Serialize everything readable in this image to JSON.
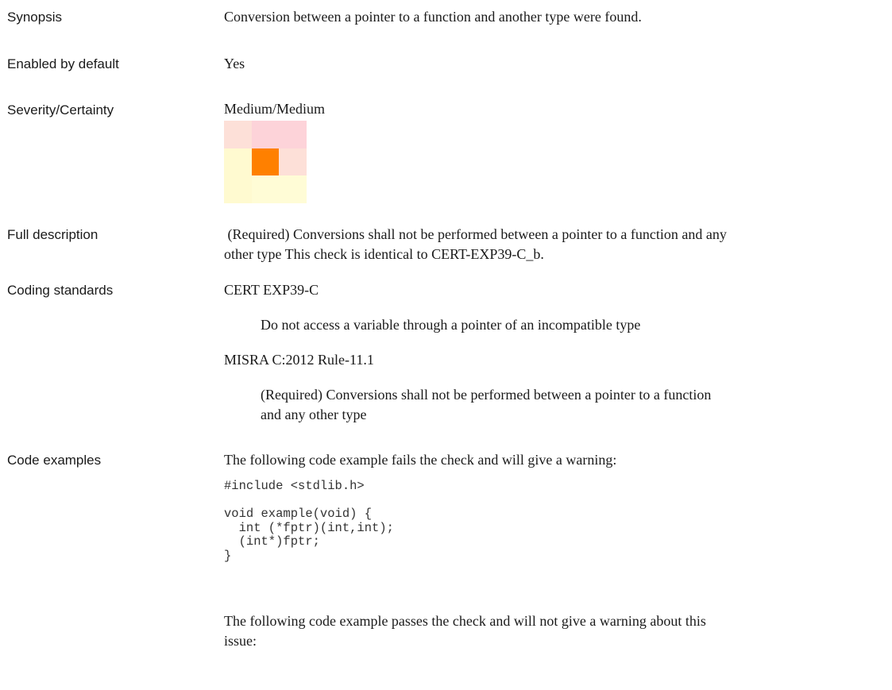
{
  "rows": {
    "synopsis": {
      "label": "Synopsis",
      "value": "Conversion between a pointer to a function and another type were found."
    },
    "enabled": {
      "label": "Enabled by default",
      "value": "Yes"
    },
    "severity": {
      "label": "Severity/Certainty",
      "value": "Medium/Medium",
      "matrix_colors": [
        [
          "#fde0d8",
          "#fdd3d9",
          "#fdd3d9"
        ],
        [
          "#fffad0",
          "#ff8000",
          "#fde0d8"
        ],
        [
          "#fffad0",
          "#fffcd6",
          "#fffcd6"
        ]
      ]
    },
    "full_description": {
      "label": "Full description",
      "lines": [
        " (Required) Conversions shall not be performed between a pointer to a function and any",
        "other type This check is identical to CERT-EXP39-C_b."
      ]
    },
    "coding_standards": {
      "label": "Coding standards",
      "items": [
        {
          "name": "CERT EXP39-C",
          "desc_lines": [
            "Do not access a variable through a pointer of an incompatible type"
          ]
        },
        {
          "name": "MISRA C:2012 Rule-11.1",
          "desc_lines": [
            "(Required) Conversions shall not be performed between a pointer to a function",
            "and any other type"
          ]
        }
      ]
    },
    "code_examples": {
      "label": "Code examples",
      "fail_intro": "The following code example fails the check and will give a warning:",
      "fail_code": "#include <stdlib.h>\n\nvoid example(void) {\n  int (*fptr)(int,int);\n  (int*)fptr;\n}",
      "pass_intro_lines": [
        "The following code example passes the check and will not give a warning about this",
        "issue:"
      ]
    }
  }
}
